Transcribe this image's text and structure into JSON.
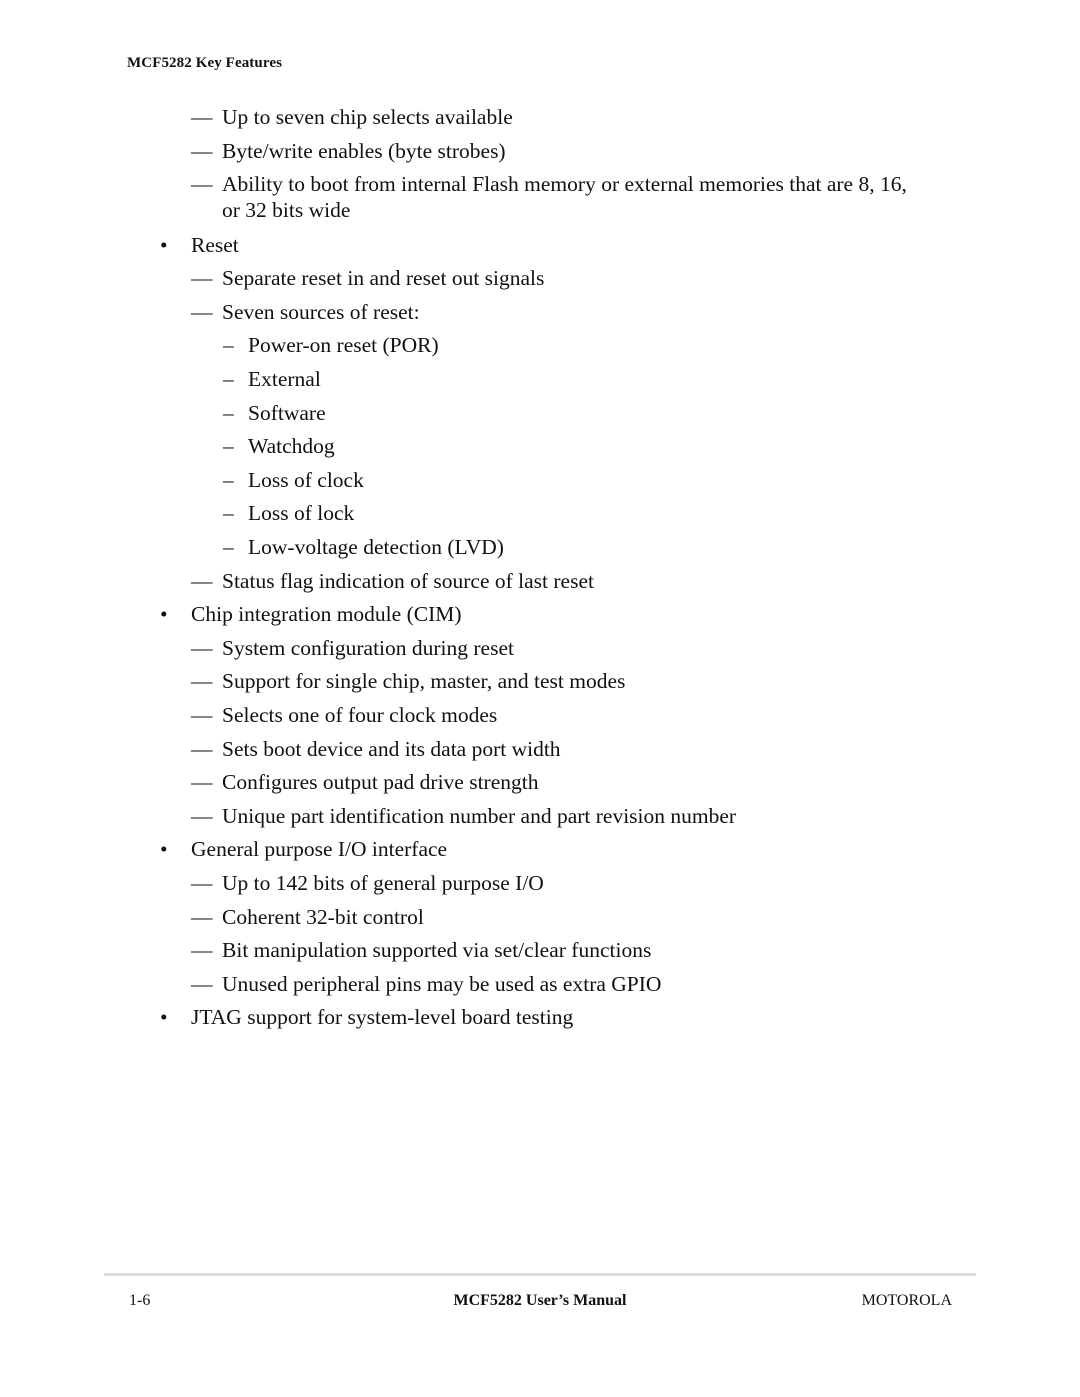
{
  "header": {
    "running_title": "MCF5282 Key Features"
  },
  "glyphs": {
    "bullet": "•",
    "em_dash": "—",
    "en_dash": "–"
  },
  "items": [
    {
      "level": 2,
      "text": "Up to seven chip selects available"
    },
    {
      "level": 2,
      "text": "Byte/write enables (byte strobes)"
    },
    {
      "level": 2,
      "text": "Ability to boot from internal Flash memory or external memories that are 8, 16,",
      "continuation": "or 32 bits wide"
    },
    {
      "level": 1,
      "text": "Reset"
    },
    {
      "level": 2,
      "text": "Separate reset in and reset out signals"
    },
    {
      "level": 2,
      "text": "Seven sources of reset:"
    },
    {
      "level": 3,
      "text": "Power-on reset (POR)"
    },
    {
      "level": 3,
      "text": "External"
    },
    {
      "level": 3,
      "text": "Software"
    },
    {
      "level": 3,
      "text": "Watchdog"
    },
    {
      "level": 3,
      "text": "Loss of clock"
    },
    {
      "level": 3,
      "text": "Loss of lock"
    },
    {
      "level": 3,
      "text": "Low-voltage detection (LVD)"
    },
    {
      "level": 2,
      "text": "Status flag indication of source of last reset"
    },
    {
      "level": 1,
      "text": "Chip integration module (CIM)"
    },
    {
      "level": 2,
      "text": "System configuration during reset"
    },
    {
      "level": 2,
      "text": "Support for single chip, master, and test modes"
    },
    {
      "level": 2,
      "text": "Selects one of four clock modes"
    },
    {
      "level": 2,
      "text": "Sets boot device and its data port width"
    },
    {
      "level": 2,
      "text": "Configures output pad drive strength"
    },
    {
      "level": 2,
      "text": "Unique part identification number and part revision number"
    },
    {
      "level": 1,
      "text": "General purpose I/O interface"
    },
    {
      "level": 2,
      "text": "Up to 142 bits of general purpose I/O"
    },
    {
      "level": 2,
      "text": "Coherent 32-bit control"
    },
    {
      "level": 2,
      "text": "Bit manipulation supported via set/clear functions"
    },
    {
      "level": 2,
      "text": "Unused peripheral pins may be used as extra GPIO"
    },
    {
      "level": 1,
      "text": "JTAG support for system-level board testing"
    }
  ],
  "footer": {
    "page_number": "1-6",
    "manual_title": "MCF5282 User’s Manual",
    "brand": "MOTOROLA"
  }
}
